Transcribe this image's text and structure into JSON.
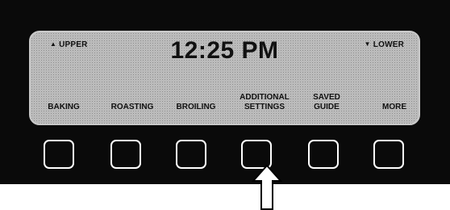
{
  "display": {
    "upper_label": "UPPER",
    "lower_label": "LOWER",
    "upper_glyph": "▲",
    "lower_glyph": "▼",
    "time": "12:25 PM"
  },
  "menu": [
    {
      "line1": "BAKING",
      "line2": ""
    },
    {
      "line1": "ROASTING",
      "line2": ""
    },
    {
      "line1": "BROILING",
      "line2": ""
    },
    {
      "line1": "ADDITIONAL",
      "line2": "SETTINGS"
    },
    {
      "line1": "SAVED",
      "line2": "GUIDE"
    },
    {
      "line1": "MORE",
      "line2": ""
    }
  ],
  "pointer": {
    "icon": "up-arrow-icon",
    "target_key_index": 3
  },
  "colors": {
    "panel": "#0a0a0a",
    "lcd": "#cfcfcf",
    "text": "#111111",
    "key_border": "#ffffff"
  }
}
